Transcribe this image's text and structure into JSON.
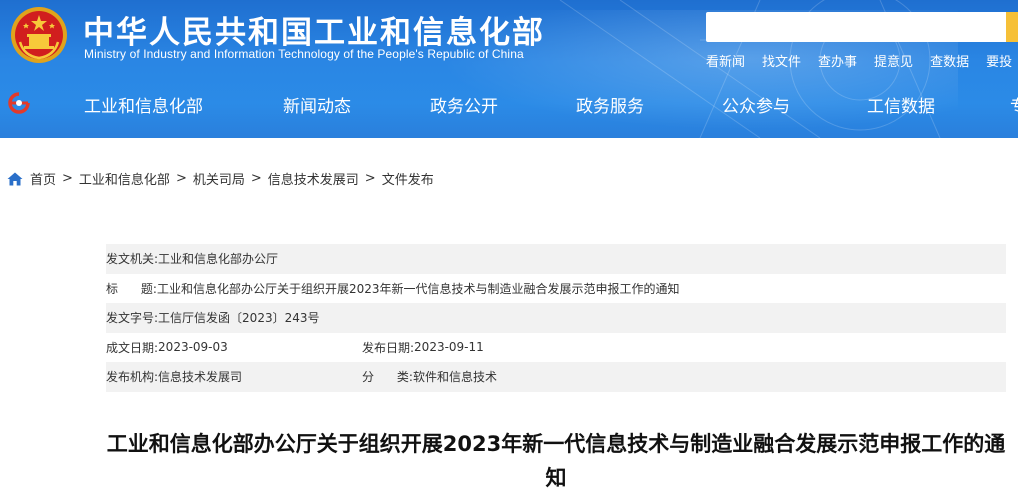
{
  "header": {
    "site_title": "中华人民共和国工业和信息化部",
    "site_subtitle": "Ministry of Industry and Information Technology of the People's Republic of China",
    "search": {
      "placeholder": ""
    },
    "quick_links": [
      "看新闻",
      "找文件",
      "查办事",
      "提意见",
      "查数据",
      "要投"
    ],
    "colors": {
      "header_blue": "#2a86e4",
      "search_button": "#f6c037"
    }
  },
  "nav": {
    "items": [
      "工业和信息化部",
      "新闻动态",
      "政务公开",
      "政务服务",
      "公众参与",
      "工信数据",
      "专"
    ]
  },
  "breadcrumb": {
    "items": [
      "首页",
      "工业和信息化部",
      "机关司局",
      "信息技术发展司",
      "文件发布"
    ],
    "separator": ">"
  },
  "meta": {
    "issuer_label": "发文机关:",
    "issuer": "工业和信息化部办公厅",
    "title_label": "标      题:",
    "title": "工业和信息化部办公厅关于组织开展2023年新一代信息技术与制造业融合发展示范申报工作的通知",
    "doc_no_label": "发文字号:",
    "doc_no": "工信厅信发函〔2023〕243号",
    "written_date_label": "成文日期:",
    "written_date": "2023-09-03",
    "publish_date_label": "发布日期:",
    "publish_date": "2023-09-11",
    "publisher_label": "发布机构:",
    "publisher": "信息技术发展司",
    "category_label": "分      类:",
    "category": "软件和信息技术"
  },
  "article": {
    "title": "工业和信息化部办公厅关于组织开展2023年新一代信息技术与制造业融合发展示范申报工作的通知"
  }
}
